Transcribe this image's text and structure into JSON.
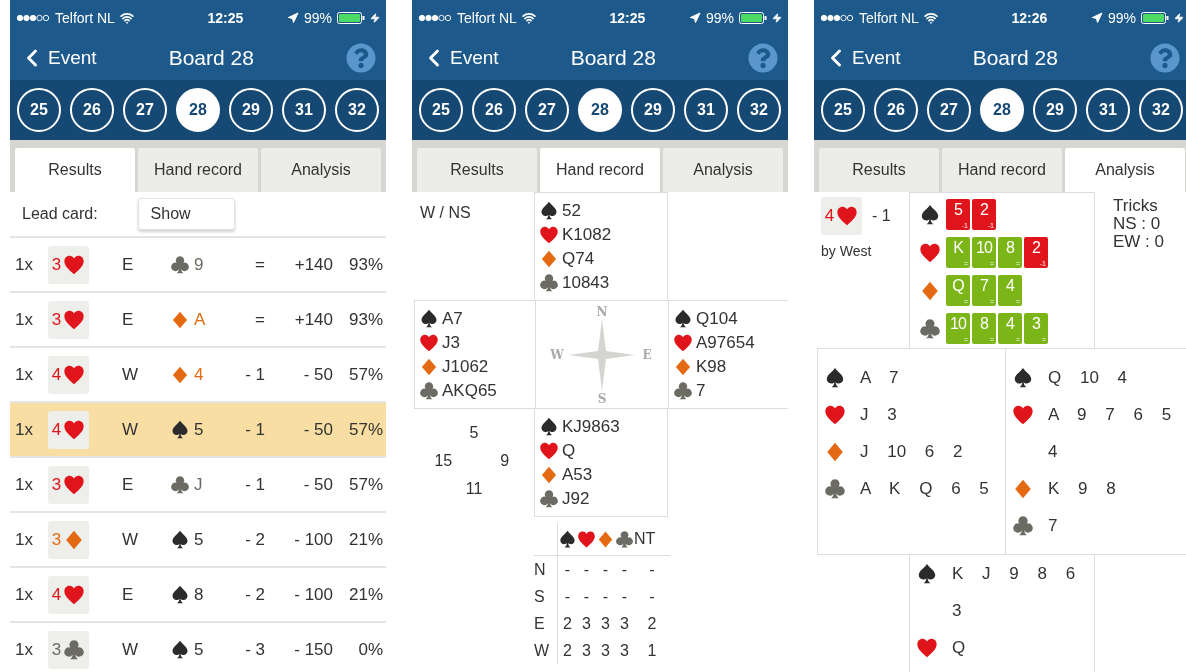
{
  "phones": [
    {
      "status": {
        "carrier": "Telfort NL",
        "time": "12:25",
        "battery": "99%"
      },
      "nav": {
        "back": "Event",
        "title": "Board 28"
      },
      "boards": [
        {
          "label": "25",
          "selected": false
        },
        {
          "label": "26",
          "selected": false
        },
        {
          "label": "27",
          "selected": false
        },
        {
          "label": "28",
          "selected": true
        },
        {
          "label": "29",
          "selected": false
        },
        {
          "label": "31",
          "selected": false
        },
        {
          "label": "32",
          "selected": false
        }
      ],
      "tabs": [
        {
          "label": "Results",
          "selected": true
        },
        {
          "label": "Hand record",
          "selected": false
        },
        {
          "label": "Analysis",
          "selected": false
        }
      ],
      "content": {
        "kind": "results",
        "lead_label": "Lead card:",
        "lead_button": "Show",
        "rows": [
          {
            "count": "1x",
            "contract": {
              "level": "3",
              "kind": "heart"
            },
            "declarer": "E",
            "lead": {
              "kind": "club",
              "card": "9"
            },
            "result": "=",
            "score": "+140",
            "percent": "93%",
            "selected": false
          },
          {
            "count": "1x",
            "contract": {
              "level": "3",
              "kind": "heart"
            },
            "declarer": "E",
            "lead": {
              "kind": "diamond",
              "card": "A"
            },
            "result": "=",
            "score": "+140",
            "percent": "93%",
            "selected": false
          },
          {
            "count": "1x",
            "contract": {
              "level": "4",
              "kind": "heart"
            },
            "declarer": "W",
            "lead": {
              "kind": "diamond",
              "card": "4"
            },
            "result": "- 1",
            "score": "- 50",
            "percent": "57%",
            "selected": false
          },
          {
            "count": "1x",
            "contract": {
              "level": "4",
              "kind": "heart"
            },
            "declarer": "W",
            "lead": {
              "kind": "spade",
              "card": "5"
            },
            "result": "- 1",
            "score": "- 50",
            "percent": "57%",
            "selected": true
          },
          {
            "count": "1x",
            "contract": {
              "level": "3",
              "kind": "heart"
            },
            "declarer": "E",
            "lead": {
              "kind": "club",
              "card": "J"
            },
            "result": "- 1",
            "score": "- 50",
            "percent": "57%",
            "selected": false
          },
          {
            "count": "1x",
            "contract": {
              "level": "3",
              "kind": "diamond"
            },
            "declarer": "W",
            "lead": {
              "kind": "spade",
              "card": "5"
            },
            "result": "- 2",
            "score": "- 100",
            "percent": "21%",
            "selected": false
          },
          {
            "count": "1x",
            "contract": {
              "level": "4",
              "kind": "heart"
            },
            "declarer": "E",
            "lead": {
              "kind": "spade",
              "card": "8"
            },
            "result": "- 2",
            "score": "- 100",
            "percent": "21%",
            "selected": false
          },
          {
            "count": "1x",
            "contract": {
              "level": "3",
              "kind": "club"
            },
            "declarer": "W",
            "lead": {
              "kind": "spade",
              "card": "5"
            },
            "result": "- 3",
            "score": "- 150",
            "percent": "0%",
            "selected": false
          }
        ]
      }
    },
    {
      "status": {
        "carrier": "Telfort NL",
        "time": "12:25",
        "battery": "99%"
      },
      "nav": {
        "back": "Event",
        "title": "Board 28"
      },
      "boards": [
        {
          "label": "25",
          "selected": false
        },
        {
          "label": "26",
          "selected": false
        },
        {
          "label": "27",
          "selected": false
        },
        {
          "label": "28",
          "selected": true
        },
        {
          "label": "29",
          "selected": false
        },
        {
          "label": "31",
          "selected": false
        },
        {
          "label": "32",
          "selected": false
        }
      ],
      "tabs": [
        {
          "label": "Results",
          "selected": false
        },
        {
          "label": "Hand record",
          "selected": true
        },
        {
          "label": "Analysis",
          "selected": false
        }
      ],
      "content": {
        "kind": "hand_record",
        "dealer": "W / NS",
        "north": [
          {
            "kind": "spade",
            "cards": "52"
          },
          {
            "kind": "heart",
            "cards": "K1082"
          },
          {
            "kind": "diamond",
            "cards": "Q74"
          },
          {
            "kind": "club",
            "cards": "10843"
          }
        ],
        "west": [
          {
            "kind": "spade",
            "cards": "A7"
          },
          {
            "kind": "heart",
            "cards": "J3"
          },
          {
            "kind": "diamond",
            "cards": "J1062"
          },
          {
            "kind": "club",
            "cards": "AKQ65"
          }
        ],
        "east": [
          {
            "kind": "spade",
            "cards": "Q104"
          },
          {
            "kind": "heart",
            "cards": "A97654"
          },
          {
            "kind": "diamond",
            "cards": "K98"
          },
          {
            "kind": "club",
            "cards": "7"
          }
        ],
        "south": [
          {
            "kind": "spade",
            "cards": "KJ9863"
          },
          {
            "kind": "heart",
            "cards": "Q"
          },
          {
            "kind": "diamond",
            "cards": "A53"
          },
          {
            "kind": "club",
            "cards": "J92"
          }
        ],
        "compass": {
          "north": "N",
          "east": "E",
          "south": "S",
          "west": "W"
        },
        "hcp": {
          "north": "5",
          "west": "15",
          "east": "9",
          "south": "11"
        },
        "tricks_table": {
          "suits": [
            {
              "kind": "spade"
            },
            {
              "kind": "heart"
            },
            {
              "kind": "diamond"
            },
            {
              "kind": "club"
            }
          ],
          "notrump": "NT",
          "rows": [
            {
              "seat": "N",
              "values": [
                "-",
                "-",
                "-",
                "-",
                "-"
              ]
            },
            {
              "seat": "S",
              "values": [
                "-",
                "-",
                "-",
                "-",
                "-"
              ]
            },
            {
              "seat": "E",
              "values": [
                "2",
                "3",
                "3",
                "3",
                "2"
              ]
            },
            {
              "seat": "W",
              "values": [
                "2",
                "3",
                "3",
                "3",
                "1"
              ]
            }
          ]
        }
      }
    },
    {
      "status": {
        "carrier": "Telfort NL",
        "time": "12:26",
        "battery": "99%"
      },
      "nav": {
        "back": "Event",
        "title": "Board 28"
      },
      "boards": [
        {
          "label": "25",
          "selected": false
        },
        {
          "label": "26",
          "selected": false
        },
        {
          "label": "27",
          "selected": false
        },
        {
          "label": "28",
          "selected": true
        },
        {
          "label": "29",
          "selected": false
        },
        {
          "label": "31",
          "selected": false
        },
        {
          "label": "32",
          "selected": false
        }
      ],
      "tabs": [
        {
          "label": "Results",
          "selected": false
        },
        {
          "label": "Hand record",
          "selected": false
        },
        {
          "label": "Analysis",
          "selected": true
        }
      ],
      "content": {
        "kind": "analysis",
        "contract": {
          "level": "4",
          "kind": "heart"
        },
        "result": "- 1",
        "by": "by West",
        "tricks": {
          "title": "Tricks",
          "lines": [
            "NS : 0",
            "EW : 0"
          ]
        },
        "north": [
          {
            "kind": "spade",
            "cards": [
              {
                "rank": "5",
                "mark": "-1",
                "good": false
              },
              {
                "rank": "2",
                "mark": "-1",
                "good": false
              }
            ]
          },
          {
            "kind": "heart",
            "cards": [
              {
                "rank": "K",
                "mark": "=",
                "good": true
              },
              {
                "rank": "10",
                "mark": "=",
                "good": true
              },
              {
                "rank": "8",
                "mark": "=",
                "good": true
              },
              {
                "rank": "2",
                "mark": "-1",
                "good": false
              }
            ]
          },
          {
            "kind": "diamond",
            "cards": [
              {
                "rank": "Q",
                "mark": "=",
                "good": true
              },
              {
                "rank": "7",
                "mark": "=",
                "good": true
              },
              {
                "rank": "4",
                "mark": "=",
                "good": true
              }
            ]
          },
          {
            "kind": "club",
            "cards": [
              {
                "rank": "10",
                "mark": "=",
                "good": true
              },
              {
                "rank": "8",
                "mark": "=",
                "good": true
              },
              {
                "rank": "4",
                "mark": "=",
                "good": true
              },
              {
                "rank": "3",
                "mark": "=",
                "good": true
              }
            ]
          }
        ],
        "west": [
          {
            "kind": "spade",
            "cards": "A 7"
          },
          {
            "kind": "heart",
            "cards": "J 3"
          },
          {
            "kind": "diamond",
            "cards": "J 10 6 2"
          },
          {
            "kind": "club",
            "cards": "A K Q 6 5"
          }
        ],
        "east": [
          {
            "kind": "spade",
            "cards": "Q 10 4"
          },
          {
            "kind": "heart",
            "cards": "A 9 7 6 5 4"
          },
          {
            "kind": "diamond",
            "cards": "K 9 8"
          },
          {
            "kind": "club",
            "cards": "7"
          }
        ],
        "south": [
          {
            "kind": "spade",
            "cards": "K J 9 8 6 3"
          },
          {
            "kind": "heart",
            "cards": "Q"
          }
        ]
      }
    }
  ]
}
